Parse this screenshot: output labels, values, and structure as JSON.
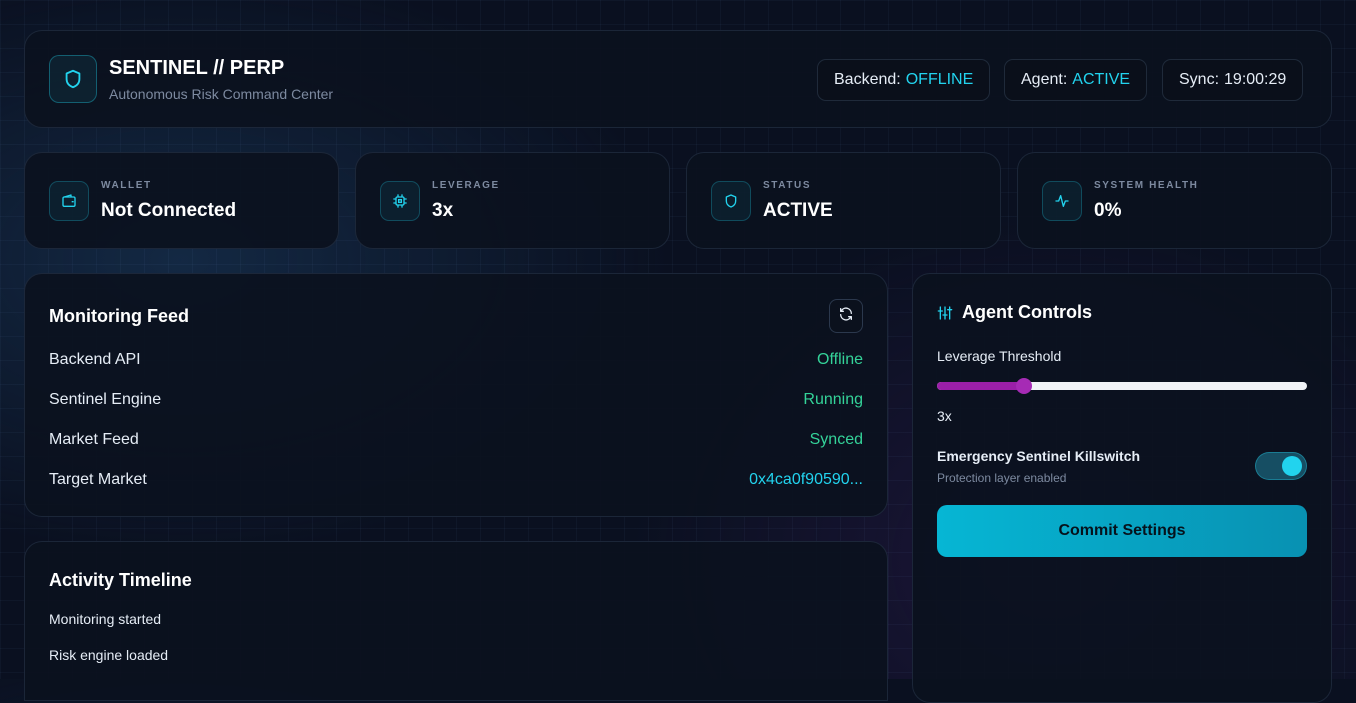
{
  "header": {
    "title": "SENTINEL // PERP",
    "subtitle": "Autonomous Risk Command Center",
    "backend": {
      "label": "Backend:",
      "value": "OFFLINE"
    },
    "agent": {
      "label": "Agent:",
      "value": "ACTIVE"
    },
    "sync": {
      "label": "Sync:",
      "value": "19:00:29"
    },
    "logo_icon": "shield-icon"
  },
  "stats": [
    {
      "label": "WALLET",
      "value": "Not Connected",
      "icon": "wallet-icon"
    },
    {
      "label": "LEVERAGE",
      "value": "3x",
      "icon": "cpu-icon"
    },
    {
      "label": "STATUS",
      "value": "ACTIVE",
      "icon": "shield-icon"
    },
    {
      "label": "SYSTEM HEALTH",
      "value": "0%",
      "icon": "activity-icon"
    }
  ],
  "monitoring": {
    "title": "Monitoring Feed",
    "refresh_icon": "refresh-icon",
    "rows": [
      {
        "label": "Backend API",
        "status": "Offline"
      },
      {
        "label": "Sentinel Engine",
        "status": "Running"
      },
      {
        "label": "Market Feed",
        "status": "Synced"
      },
      {
        "label": "Target Market",
        "status": "0x4ca0f90590..."
      }
    ]
  },
  "timeline": {
    "title": "Activity Timeline",
    "items": [
      "Monitoring started",
      "Risk engine loaded"
    ]
  },
  "controls": {
    "title": "Agent Controls",
    "icon": "sliders-icon",
    "leverage_label": "Leverage Threshold",
    "leverage_value": "3x",
    "leverage_fraction": 0.235,
    "killswitch_label": "Emergency Sentinel Killswitch",
    "killswitch_sub": "Protection layer enabled",
    "killswitch_on": true,
    "commit_label": "Commit Settings"
  },
  "colors": {
    "accent": "#22d3ee",
    "success": "#34d399",
    "slider": "#9b1fa8"
  }
}
